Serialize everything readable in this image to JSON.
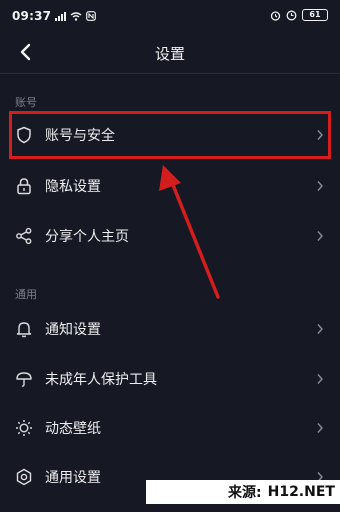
{
  "status_bar": {
    "time": "09:37",
    "battery": "61"
  },
  "header": {
    "title": "设置"
  },
  "sections": [
    {
      "label": "账号",
      "items": [
        {
          "label": "账号与安全",
          "icon": "shield-icon"
        },
        {
          "label": "隐私设置",
          "icon": "lock-icon"
        },
        {
          "label": "分享个人主页",
          "icon": "share-icon"
        }
      ]
    },
    {
      "label": "通用",
      "items": [
        {
          "label": "通知设置",
          "icon": "bell-icon"
        },
        {
          "label": "未成年人保护工具",
          "icon": "umbrella-icon"
        },
        {
          "label": "动态壁纸",
          "icon": "sun-icon"
        },
        {
          "label": "通用设置",
          "icon": "settings-icon"
        }
      ]
    }
  ],
  "watermark": {
    "prefix": "来源:",
    "site": "H12.NET"
  },
  "colors": {
    "background": "#161823",
    "highlight": "#d41e1e",
    "arrow": "#d41e1e",
    "section_label": "#7d7f89"
  }
}
